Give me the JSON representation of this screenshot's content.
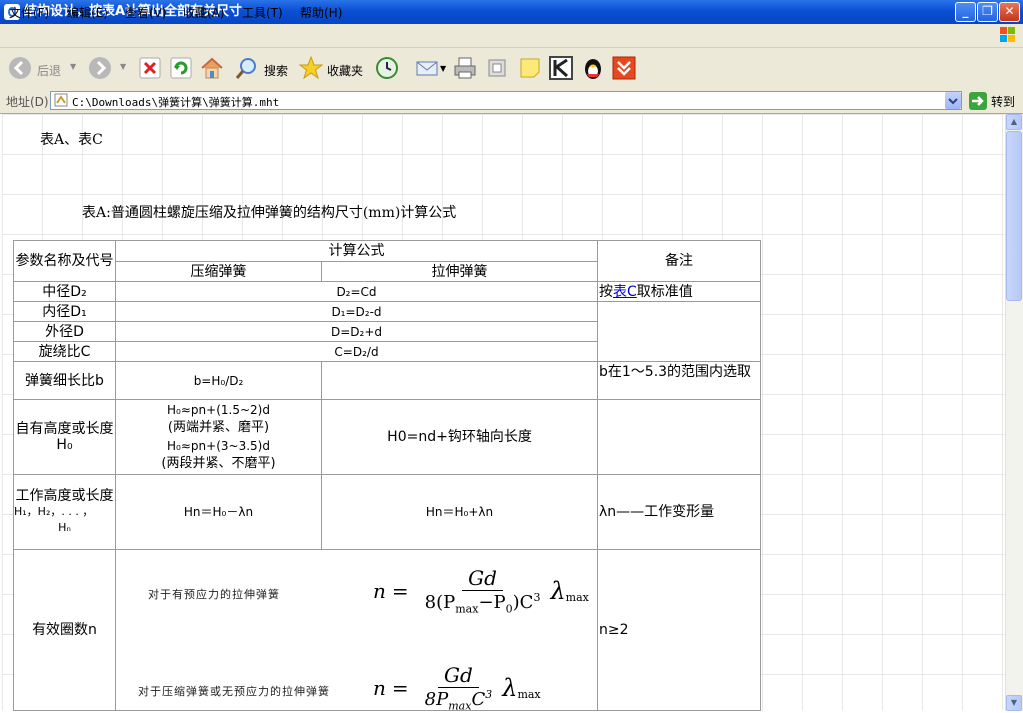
{
  "window": {
    "title": "结构设计，按表A计算出全部有关尺寸"
  },
  "menu": [
    "文件(F)",
    "编辑(E)",
    "查看(V)",
    "收藏(A)",
    "工具(T)",
    "帮助(H)"
  ],
  "toolbar": {
    "back": "后退",
    "search": "搜索",
    "favorites": "收藏夹"
  },
  "address": {
    "label": "地址(D)",
    "value": "C:\\Downloads\\弹簧计算\\弹簧计算.mht",
    "go": "转到"
  },
  "page": {
    "heading1": "表A、表C",
    "heading2": "表A:普通圆柱螺旋压缩及拉伸弹簧的结构尺寸(mm)计算公式",
    "table": {
      "h_param": "参数名称及代号",
      "h_formula": "计算公式",
      "h_note": "备注",
      "h_comp": "压缩弹簧",
      "h_ext": "拉伸弹簧",
      "r1_name": "中径D₂",
      "r1_formula": "D₂=Cd",
      "r1_note_pre": "按",
      "r1_note_link": "表C",
      "r1_note_post": "取标准值",
      "r2_name": "内径D₁",
      "r2_formula": "D₁=D₂-d",
      "r3_name": "外径D",
      "r3_formula": "D=D₂+d",
      "r4_name": "旋绕比C",
      "r4_formula": "C=D₂/d",
      "r5_name": "弹簧细长比b",
      "r5_comp": "b=H₀/D₂",
      "r5_note": "b在1～5.3的范围内选取",
      "r6_name": "自有高度或长度H₀",
      "r6_comp": [
        "H₀≈pn+(1.5~2)d",
        "(两端并紧、磨平)",
        "H₀≈pn+(3~3.5)d",
        "(两段并紧、不磨平)"
      ],
      "r6_ext": "H0=nd+钩环轴向长度",
      "r7_name": "工作高度或长度",
      "r7_sub": "H₁，H₂，. . . ，",
      "r7_sub2": "Hₙ",
      "r7_comp": "Hn＝H₀－λn",
      "r7_ext": "Hn＝H₀+λn",
      "r7_note": "λn——工作变形量",
      "r8_name": "有效圈数n",
      "r8_cap1": "对于有预应力的拉伸弹簧",
      "r8_cap2": "对于压缩弹簧或无预应力的拉伸弹簧",
      "r8_note": "n≥2",
      "f_n": "n",
      "f_eq": "=",
      "f_num": "Gd",
      "f_den1": "8(P",
      "f_max": "max",
      "f_minus": "−P",
      "f_zero": "0",
      "f_close": ")C",
      "f_cube": "3",
      "f_lambda": "λ",
      "f_lmax": "max",
      "f_den2": "8P",
      "f_c2": "C",
      "f_c3": "3"
    }
  }
}
